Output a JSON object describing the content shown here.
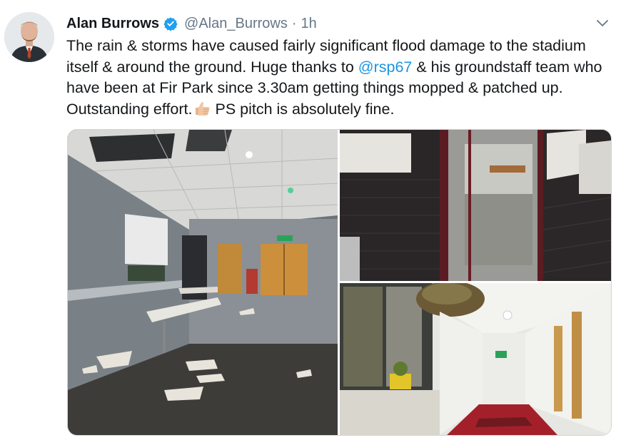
{
  "tweet": {
    "display_name": "Alan Burrows",
    "handle": "@Alan_Burrows",
    "separator": "·",
    "time": "1h",
    "text_part1": "The rain & storms have caused fairly significant flood damage to the stadium itself & around the ground. Huge thanks to ",
    "mention": "@rsp67",
    "text_part2": " & his groundstaff team who have been at Fir Park since 3.30am getting things mopped & patched up. Outstanding effort.",
    "text_part3": " PS pitch is absolutely fine.",
    "emoji": "thumbs-up-icon",
    "verified": true
  },
  "photos": [
    {
      "id": "photo-1",
      "subject": "damaged-room"
    },
    {
      "id": "photo-2",
      "subject": "flooded-corridor-door"
    },
    {
      "id": "photo-3",
      "subject": "corridor-ceiling-damage"
    }
  ],
  "colors": {
    "link": "#1b95e0",
    "secondary_text": "#657786",
    "verified_badge": "#1da1f2",
    "border": "#ccd6dd"
  }
}
